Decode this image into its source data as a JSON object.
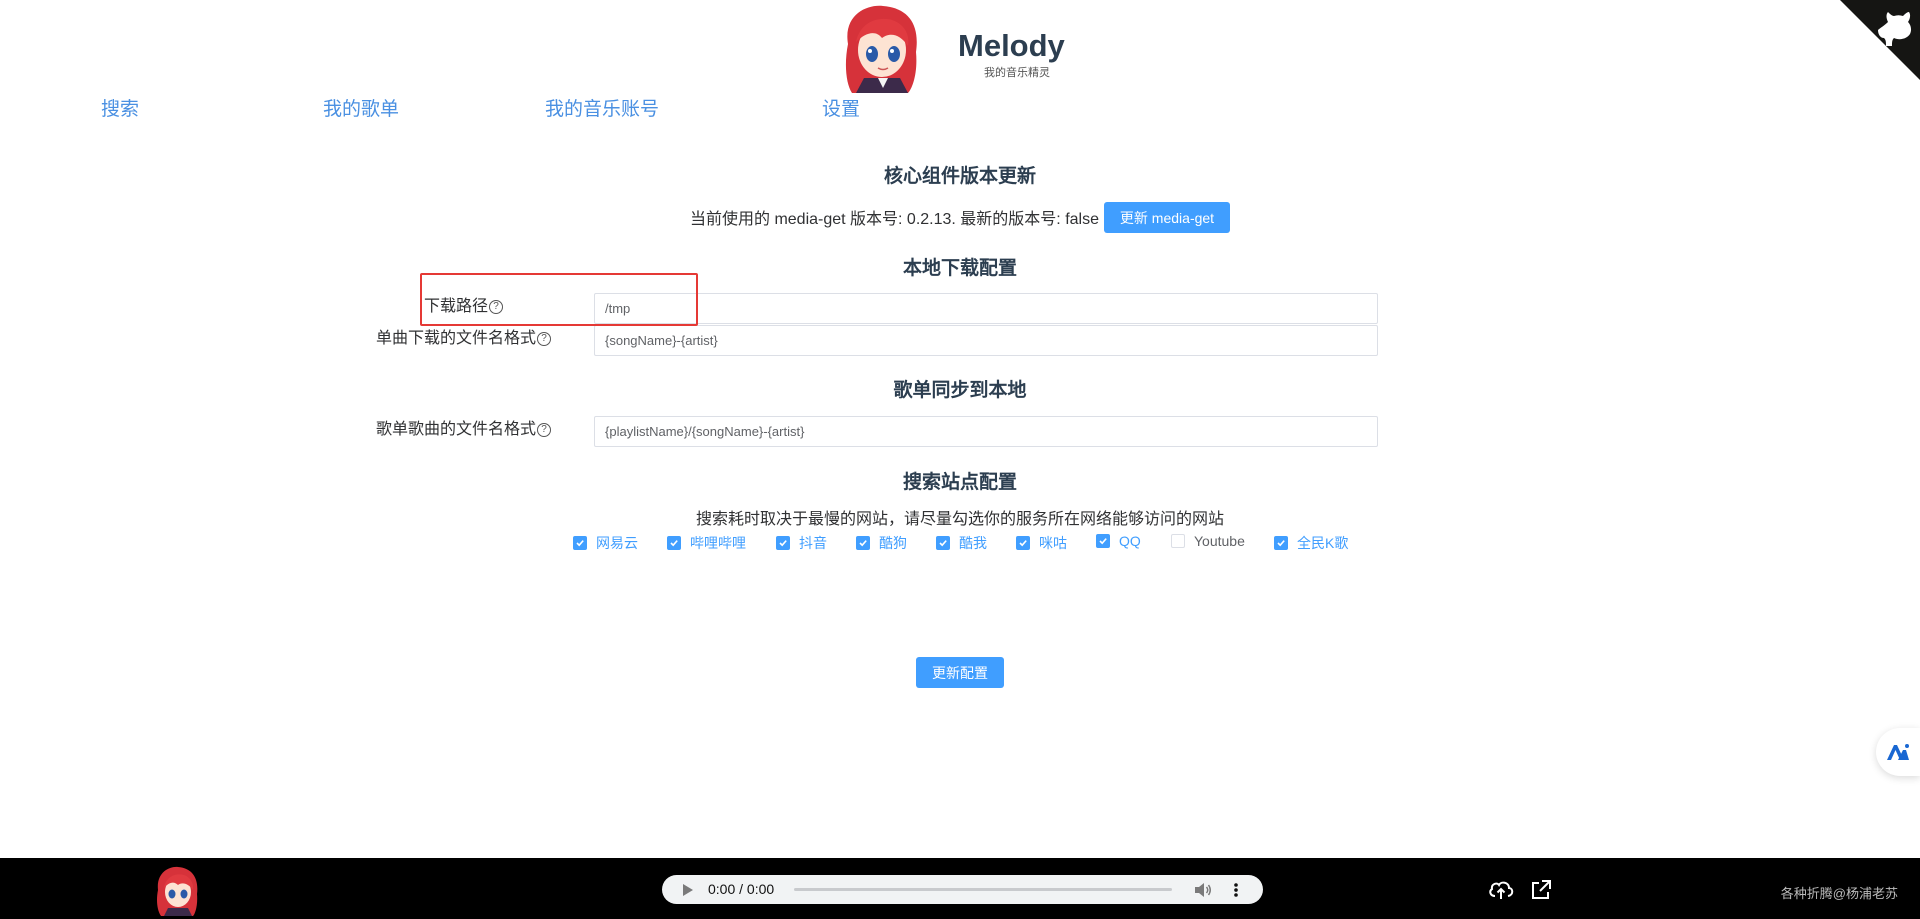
{
  "header": {
    "title": "Melody",
    "subtitle": "我的音乐精灵"
  },
  "nav": [
    {
      "label": "搜索"
    },
    {
      "label": "我的歌单"
    },
    {
      "label": "我的音乐账号"
    },
    {
      "label": "设置"
    }
  ],
  "core": {
    "title": "核心组件版本更新",
    "version_text": "当前使用的 media-get 版本号: 0.2.13. 最新的版本号: false",
    "update_button": "更新 media-get"
  },
  "download": {
    "title": "本地下载配置",
    "path_label": "下载路径",
    "path_value": "/tmp",
    "filename_label": "单曲下载的文件名格式",
    "filename_value": "{songName}-{artist}"
  },
  "sync": {
    "title": "歌单同步到本地",
    "filename_label": "歌单歌曲的文件名格式",
    "filename_value": "{playlistName}/{songName}-{artist}"
  },
  "sites": {
    "title": "搜索站点配置",
    "tip": "搜索耗时取决于最慢的网站，请尽量勾选你的服务所在网络能够访问的网站",
    "options": [
      {
        "label": "网易云",
        "checked": true
      },
      {
        "label": "哔哩哔哩",
        "checked": true
      },
      {
        "label": "抖音",
        "checked": true
      },
      {
        "label": "酷狗",
        "checked": true
      },
      {
        "label": "酷我",
        "checked": true
      },
      {
        "label": "咪咕",
        "checked": true
      },
      {
        "label": "QQ",
        "checked": true
      },
      {
        "label": "Youtube",
        "checked": false
      },
      {
        "label": "全民K歌",
        "checked": true
      }
    ]
  },
  "save_button": "更新配置",
  "player": {
    "time": "0:00 / 0:00"
  },
  "footer": {
    "credit": "各种折腾@杨浦老苏"
  },
  "colors": {
    "primary": "#409eff",
    "nav_link": "#4a90e2",
    "highlight": "#e53935",
    "footer_bg": "#000000"
  },
  "icons": {
    "corner": "github-cat-icon",
    "side": "ai-assistant-icon",
    "upload": "cloud-upload-icon",
    "external": "external-link-icon"
  }
}
